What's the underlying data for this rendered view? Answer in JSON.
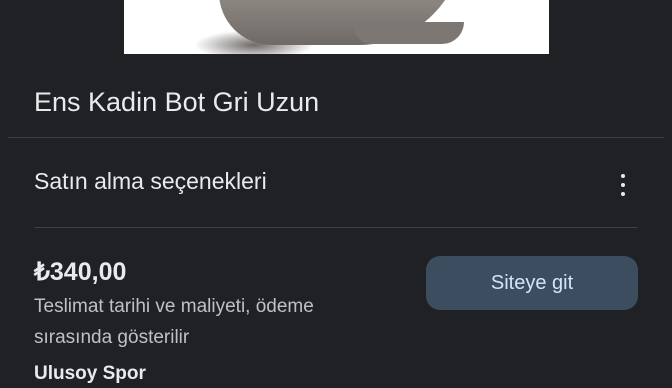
{
  "product": {
    "title": "Ens Kadin Bot Gri Uzun",
    "image_alt": "boot-image"
  },
  "purchase_options": {
    "header": "Satın alma seçenekleri",
    "menu_icon": "more-vert-icon"
  },
  "offer": {
    "price": "₺340,00",
    "delivery_note": "Teslimat tarihi ve maliyeti, ödeme sırasında gösterilir",
    "button_label": "Siteye git",
    "seller": "Ulusoy Spor"
  }
}
